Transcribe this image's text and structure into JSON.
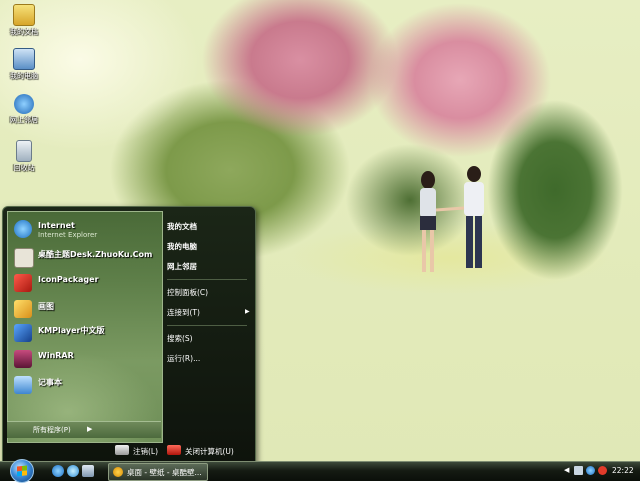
{
  "desktop": {
    "icons": [
      {
        "label": "我的文档",
        "icon": "folder-icon"
      },
      {
        "label": "我的电脑",
        "icon": "computer-icon"
      },
      {
        "label": "网上邻居",
        "icon": "network-icon"
      },
      {
        "label": "回收站",
        "icon": "recycle-bin-icon"
      }
    ]
  },
  "start_menu": {
    "pinned": [
      {
        "label": "Internet",
        "sub": "Internet Explorer",
        "icon": "internet-explorer-icon",
        "color": "#2c8fd6"
      },
      {
        "label": "桌酷主题Desk.ZhuoKu.Com",
        "icon": "zhuoku-icon",
        "color": "#e8e4d8"
      },
      {
        "label": "IconPackager",
        "icon": "iconpackager-icon",
        "color": "#d8342a"
      },
      {
        "label": "画图",
        "icon": "paint-icon",
        "color": "#f2c230"
      },
      {
        "label": "KMPlayer中文版",
        "icon": "kmplayer-icon",
        "color": "#2a6fc0"
      },
      {
        "label": "WinRAR",
        "icon": "winrar-icon",
        "color": "#8b2a55"
      },
      {
        "label": "记事本",
        "icon": "notepad-icon",
        "color": "#5aa0e0"
      }
    ],
    "all_programs": "所有程序(P)",
    "right": {
      "my_documents": "我的文档",
      "my_computer": "我的电脑",
      "network": "网上邻居",
      "control_panel": "控制面板(C)",
      "connect_to": "连接到(T)",
      "search": "搜索(S)",
      "run": "运行(R)..."
    },
    "logoff": "注销(L)",
    "shutdown": "关闭计算机(U)"
  },
  "taskbar": {
    "task_label": "桌面 - 壁纸 - 桌酷壁...",
    "clock": "22:22"
  }
}
